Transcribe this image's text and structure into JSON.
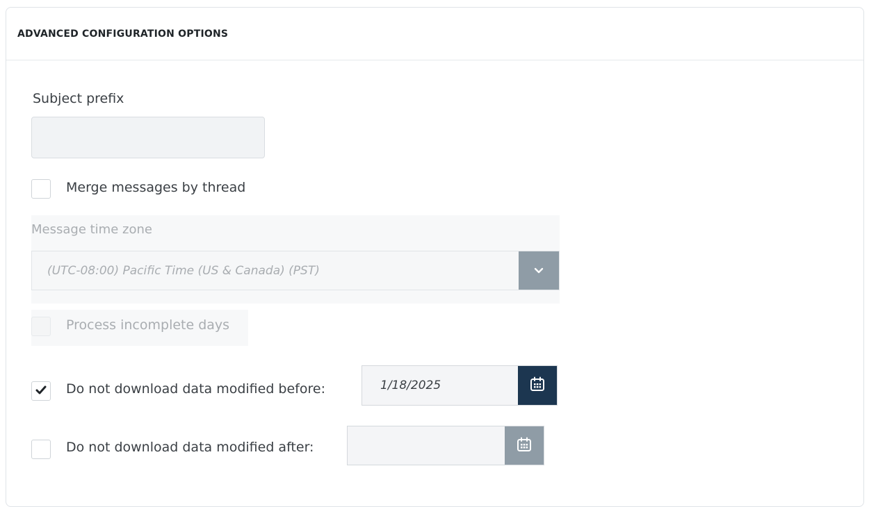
{
  "section": {
    "title": "ADVANCED CONFIGURATION OPTIONS"
  },
  "subject_prefix": {
    "label": "Subject prefix",
    "value": ""
  },
  "merge_messages": {
    "label": "Merge messages by thread",
    "checked": false
  },
  "time_zone": {
    "label": "Message time zone",
    "selected": "(UTC-08:00) Pacific Time (US & Canada) (PST)",
    "disabled": true,
    "icon": "chevron-down-icon"
  },
  "process_incomplete": {
    "label": "Process incomplete days",
    "checked": false,
    "disabled": true
  },
  "modified_before": {
    "label": "Do not download data modified before:",
    "checked": true,
    "date": "1/18/2025",
    "icon": "calendar-icon"
  },
  "modified_after": {
    "label": "Do not download data modified after:",
    "checked": false,
    "date": "",
    "icon": "calendar-icon"
  },
  "colors": {
    "calendar_active": "#1c3650",
    "calendar_inactive": "#8f9ca6",
    "select_button": "#8f9ca6"
  }
}
